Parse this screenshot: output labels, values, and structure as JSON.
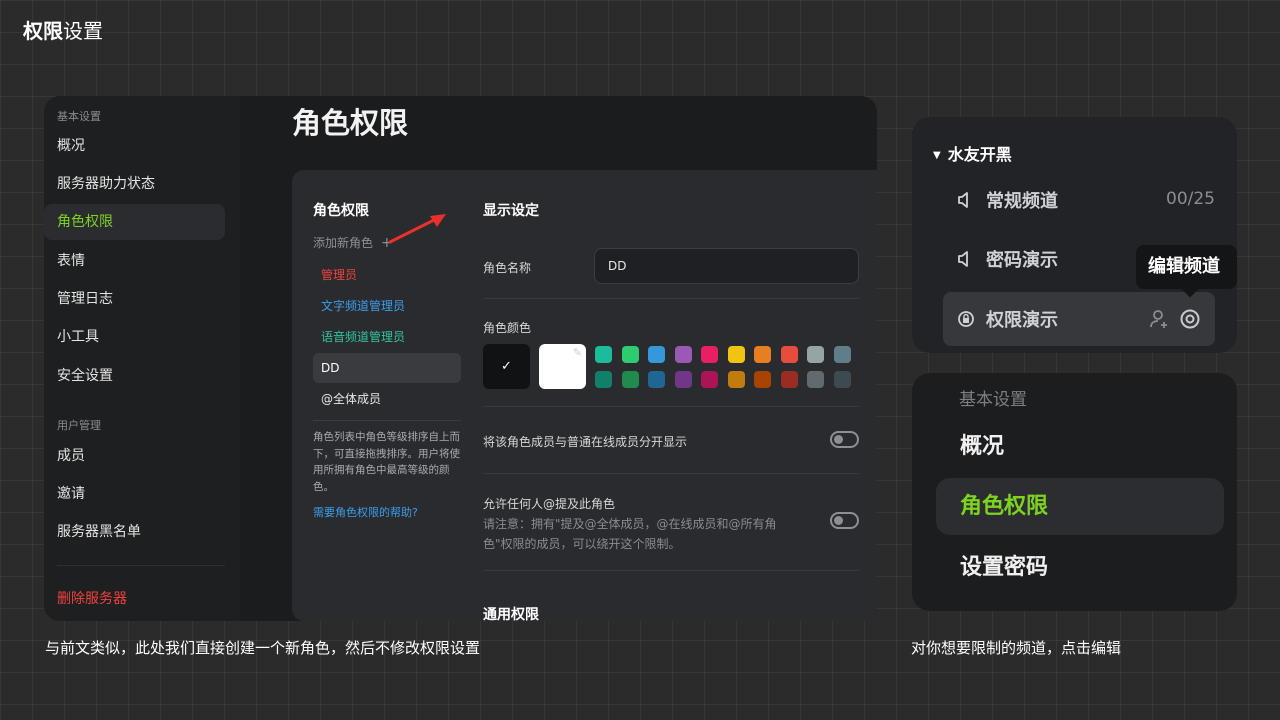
{
  "page_title": {
    "bold": "权限",
    "rest": "设置"
  },
  "sidebar": {
    "section_basic": "基本设置",
    "items_basic": [
      {
        "label": "概况",
        "active": false
      },
      {
        "label": "服务器助力状态",
        "active": false
      },
      {
        "label": "角色权限",
        "active": true
      },
      {
        "label": "表情",
        "active": false
      },
      {
        "label": "管理日志",
        "active": false
      },
      {
        "label": "小工具",
        "active": false
      },
      {
        "label": "安全设置",
        "active": false
      }
    ],
    "section_users": "用户管理",
    "items_users": [
      {
        "label": "成员"
      },
      {
        "label": "邀请"
      },
      {
        "label": "服务器黑名单"
      }
    ],
    "danger_item": "删除服务器"
  },
  "main": {
    "heading": "角色权限",
    "roles": {
      "title": "角色权限",
      "add_label": "添加新角色",
      "add_icon": "plus-icon",
      "items": [
        {
          "label": "管理员",
          "color": "#f0413e"
        },
        {
          "label": "文字频道管理员",
          "color": "#3a9eed"
        },
        {
          "label": "语音频道管理员",
          "color": "#31c4a2"
        },
        {
          "label": "DD",
          "color": "#ffffff",
          "selected": true
        },
        {
          "label": "@全体成员",
          "color": "#e8e8e8"
        }
      ],
      "note": "角色列表中角色等级排序自上而下，可直接拖拽排序。用户将使用所拥有角色中最高等级的颜色。",
      "help_link": "需要角色权限的帮助?"
    },
    "display": {
      "title": "显示设定",
      "name_label": "角色名称",
      "name_value": "DD",
      "color_label": "角色颜色",
      "selected_check": "✓",
      "palette_row1": [
        "#1abc9c",
        "#2ecc71",
        "#3498db",
        "#9b59b6",
        "#e91e63",
        "#f1c40f",
        "#e67e22",
        "#e74c3c",
        "#95a5a6",
        "#607d8b"
      ],
      "palette_row2": [
        "#11806a",
        "#1f8b4c",
        "#206694",
        "#71368a",
        "#ad1457",
        "#c27c0e",
        "#a84300",
        "#992d22",
        "#606b6f",
        "#3e4a52"
      ],
      "separate_label": "将该角色成员与普通在线成员分开显示",
      "separate_on": false,
      "mention_label": "允许任何人@提及此角色",
      "mention_desc": "请注意：拥有\"提及@全体成员，@在线成员和@所有角色\"权限的成员，可以绕开这个限制。",
      "mention_on": false,
      "next_section": "通用权限"
    }
  },
  "channels": {
    "group": "水友开黑",
    "rows": [
      {
        "name": "常规频道",
        "count": "00/25",
        "icon": "voice-channel-icon"
      },
      {
        "name": "密码演示",
        "icon": "voice-channel-icon"
      },
      {
        "name": "权限演示",
        "icon": "locked-voice-channel-icon",
        "highlighted": true
      }
    ],
    "tooltip": "编辑频道",
    "action_icons": [
      "add-member-icon",
      "settings-gear-icon"
    ]
  },
  "zoom": {
    "section": "基本设置",
    "items": [
      {
        "label": "概况",
        "active": false
      },
      {
        "label": "角色权限",
        "active": true
      },
      {
        "label": "设置密码",
        "active": false
      }
    ]
  },
  "captions": {
    "left": "与前文类似，此处我们直接创建一个新角色，然后不修改权限设置",
    "right": "对你想要限制的频道，点击编辑"
  }
}
